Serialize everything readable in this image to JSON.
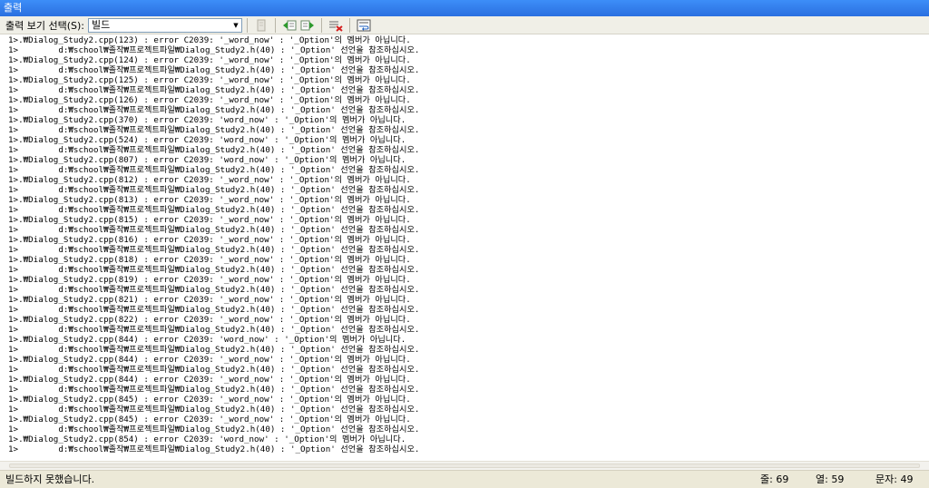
{
  "window": {
    "title": "출력"
  },
  "toolbar": {
    "show_label": "출력 보기 선택(S):",
    "selected": "빌드",
    "icons": [
      "page-icon",
      "prev-message-icon",
      "next-message-icon",
      "clear-all-icon",
      "word-wrap-icon"
    ]
  },
  "output": {
    "lines": [
      "1>.₩Dialog_Study2.cpp(123) : error C2039: '_word_now' : '_Option'의 멤버가 아닙니다.",
      "1>        d:₩school₩졸작₩프로젝트파일₩Dialog_Study2.h(40) : '_Option' 선언을 참조하십시오.",
      "1>.₩Dialog_Study2.cpp(124) : error C2039: '_word_now' : '_Option'의 멤버가 아닙니다.",
      "1>        d:₩school₩졸작₩프로젝트파일₩Dialog_Study2.h(40) : '_Option' 선언을 참조하십시오.",
      "1>.₩Dialog_Study2.cpp(125) : error C2039: '_word_now' : '_Option'의 멤버가 아닙니다.",
      "1>        d:₩school₩졸작₩프로젝트파일₩Dialog_Study2.h(40) : '_Option' 선언을 참조하십시오.",
      "1>.₩Dialog_Study2.cpp(126) : error C2039: '_word_now' : '_Option'의 멤버가 아닙니다.",
      "1>        d:₩school₩졸작₩프로젝트파일₩Dialog_Study2.h(40) : '_Option' 선언을 참조하십시오.",
      "1>.₩Dialog_Study2.cpp(370) : error C2039: 'word_now' : '_Option'의 멤버가 아닙니다.",
      "1>        d:₩school₩졸작₩프로젝트파일₩Dialog_Study2.h(40) : '_Option' 선언을 참조하십시오.",
      "1>.₩Dialog_Study2.cpp(524) : error C2039: 'word_now' : '_Option'의 멤버가 아닙니다.",
      "1>        d:₩school₩졸작₩프로젝트파일₩Dialog_Study2.h(40) : '_Option' 선언을 참조하십시오.",
      "1>.₩Dialog_Study2.cpp(807) : error C2039: 'word_now' : '_Option'의 멤버가 아닙니다.",
      "1>        d:₩school₩졸작₩프로젝트파일₩Dialog_Study2.h(40) : '_Option' 선언을 참조하십시오.",
      "1>.₩Dialog_Study2.cpp(812) : error C2039: '_word_now' : '_Option'의 멤버가 아닙니다.",
      "1>        d:₩school₩졸작₩프로젝트파일₩Dialog_Study2.h(40) : '_Option' 선언을 참조하십시오.",
      "1>.₩Dialog_Study2.cpp(813) : error C2039: '_word_now' : '_Option'의 멤버가 아닙니다.",
      "1>        d:₩school₩졸작₩프로젝트파일₩Dialog_Study2.h(40) : '_Option' 선언을 참조하십시오.",
      "1>.₩Dialog_Study2.cpp(815) : error C2039: '_word_now' : '_Option'의 멤버가 아닙니다.",
      "1>        d:₩school₩졸작₩프로젝트파일₩Dialog_Study2.h(40) : '_Option' 선언을 참조하십시오.",
      "1>.₩Dialog_Study2.cpp(816) : error C2039: '_word_now' : '_Option'의 멤버가 아닙니다.",
      "1>        d:₩school₩졸작₩프로젝트파일₩Dialog_Study2.h(40) : '_Option' 선언을 참조하십시오.",
      "1>.₩Dialog_Study2.cpp(818) : error C2039: '_word_now' : '_Option'의 멤버가 아닙니다.",
      "1>        d:₩school₩졸작₩프로젝트파일₩Dialog_Study2.h(40) : '_Option' 선언을 참조하십시오.",
      "1>.₩Dialog_Study2.cpp(819) : error C2039: '_word_now' : '_Option'의 멤버가 아닙니다.",
      "1>        d:₩school₩졸작₩프로젝트파일₩Dialog_Study2.h(40) : '_Option' 선언을 참조하십시오.",
      "1>.₩Dialog_Study2.cpp(821) : error C2039: '_word_now' : '_Option'의 멤버가 아닙니다.",
      "1>        d:₩school₩졸작₩프로젝트파일₩Dialog_Study2.h(40) : '_Option' 선언을 참조하십시오.",
      "1>.₩Dialog_Study2.cpp(822) : error C2039: '_word_now' : '_Option'의 멤버가 아닙니다.",
      "1>        d:₩school₩졸작₩프로젝트파일₩Dialog_Study2.h(40) : '_Option' 선언을 참조하십시오.",
      "1>.₩Dialog_Study2.cpp(844) : error C2039: 'word_now' : '_Option'의 멤버가 아닙니다.",
      "1>        d:₩school₩졸작₩프로젝트파일₩Dialog_Study2.h(40) : '_Option' 선언을 참조하십시오.",
      "1>.₩Dialog_Study2.cpp(844) : error C2039: '_word_now' : '_Option'의 멤버가 아닙니다.",
      "1>        d:₩school₩졸작₩프로젝트파일₩Dialog_Study2.h(40) : '_Option' 선언을 참조하십시오.",
      "1>.₩Dialog_Study2.cpp(844) : error C2039: '_word_now' : '_Option'의 멤버가 아닙니다.",
      "1>        d:₩school₩졸작₩프로젝트파일₩Dialog_Study2.h(40) : '_Option' 선언을 참조하십시오.",
      "1>.₩Dialog_Study2.cpp(845) : error C2039: '_word_now' : '_Option'의 멤버가 아닙니다.",
      "1>        d:₩school₩졸작₩프로젝트파일₩Dialog_Study2.h(40) : '_Option' 선언을 참조하십시오.",
      "1>.₩Dialog_Study2.cpp(845) : error C2039: '_word_now' : '_Option'의 멤버가 아닙니다.",
      "1>        d:₩school₩졸작₩프로젝트파일₩Dialog_Study2.h(40) : '_Option' 선언을 참조하십시오.",
      "1>.₩Dialog_Study2.cpp(854) : error C2039: 'word_now' : '_Option'의 멤버가 아닙니다.",
      "1>        d:₩school₩졸작₩프로젝트파일₩Dialog_Study2.h(40) : '_Option' 선언을 참조하십시오."
    ]
  },
  "status": {
    "message": "빌드하지 못했습니다.",
    "line": "줄: 69",
    "col": "열: 59",
    "char": "문자: 49"
  }
}
